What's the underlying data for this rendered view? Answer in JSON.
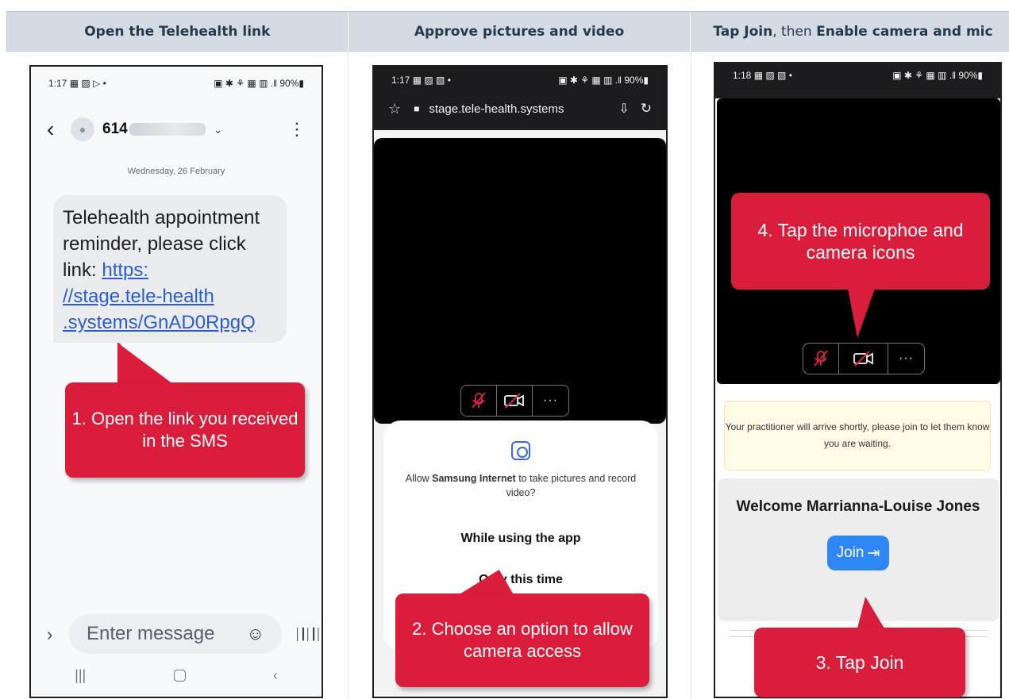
{
  "headers": [
    {
      "parts": [
        {
          "text": "Open the Telehealth link",
          "bold": true
        }
      ]
    },
    {
      "parts": [
        {
          "text": "Approve pictures and video",
          "bold": true
        }
      ]
    },
    {
      "parts": [
        {
          "text": "Tap Join",
          "bold": true
        },
        {
          "text": ", then ",
          "bold": false
        },
        {
          "text": "Enable camera and mic",
          "bold": true
        }
      ]
    }
  ],
  "phone1": {
    "status_time": "1:17 ▦ ▨ ▷ •",
    "status_right": "▣ ✱ ⚘ ▦ ▥ .‖ 90%▮",
    "back": "‹",
    "avatar": "●",
    "number": "614",
    "chevron": "⌄",
    "kebab": "⋮",
    "date": "Wednesday, 26 February",
    "message_lead": "Telehealth appointment reminder, please click link:",
    "message_link_1": "https:",
    "message_link_2": "//stage.tele-health",
    "message_link_3": ".systems/GnAD0RpgQ",
    "plus": "›",
    "input_placeholder": "Enter message",
    "smile": "☺",
    "voice": "│┃│┃│",
    "nav": [
      "|||",
      "",
      "‹"
    ],
    "callout": "1. Open the link you received in the SMS"
  },
  "phone2": {
    "status_time": "1:17 ▦ ▨ ▧ •",
    "status_right": "▣ ✱ ⚘ ▦ ▥ .‖ 90%▮",
    "star": "☆",
    "lock": "■",
    "url": "stage.tele-health.systems",
    "download": "⇩",
    "refresh": "↻",
    "more": "···",
    "perm_prefix": "Allow ",
    "perm_app": "Samsung Internet",
    "perm_suffix": " to take pictures and record video?",
    "option_1": "While using the app",
    "option_2": "Only this time",
    "callout": "2. Choose an option to allow camera access"
  },
  "phone3": {
    "status_time": "1:18 ▦ ▨ ▧ •",
    "status_right": "▣ ✱ ⚘ ▦ ▥ .‖ 90%▮",
    "more": "···",
    "notice": "Your practitioner will arrive shortly, please join to let them know you are waiting.",
    "welcome": "Welcome Marrianna-Louise Jones",
    "join": "Join",
    "join_icon": "⇥",
    "callout_mic": "4. Tap the microphoe and camera icons",
    "callout_join": "3. Tap Join"
  },
  "colors": {
    "header_bg": "#d4dbe2",
    "header_text": "#263a4d",
    "callout": "#d91d3b",
    "link": "#2b5ec8",
    "join": "#2f86f6",
    "mic_slash": "#d9253d"
  }
}
